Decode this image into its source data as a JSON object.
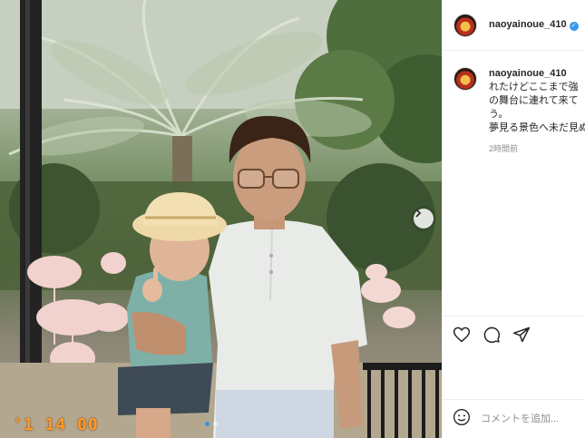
{
  "post": {
    "image_alt": "",
    "date_stamp": "'1 14 00",
    "carousel": {
      "count": 2,
      "active": 1
    }
  },
  "header": {
    "username": "naoyainoue_410",
    "verified": true
  },
  "caption": {
    "username": "naoyainoue_410",
    "lines": [
      "れたけどここまで強",
      "の舞台に連れて来て",
      "う。",
      "夢見る景色へ未だ見ぬ"
    ],
    "time_ago": "2時間前"
  },
  "actions": {
    "like_icon": "heart-icon",
    "comment_icon": "comment-icon",
    "share_icon": "send-icon"
  },
  "comment_box": {
    "placeholder": "コメントを追加...",
    "emoji_icon": "smiley-icon"
  },
  "colors": {
    "verified_badge": "#3897f0",
    "date_stamp": "#ff9a2a",
    "carousel_active": "#2f95f0"
  }
}
